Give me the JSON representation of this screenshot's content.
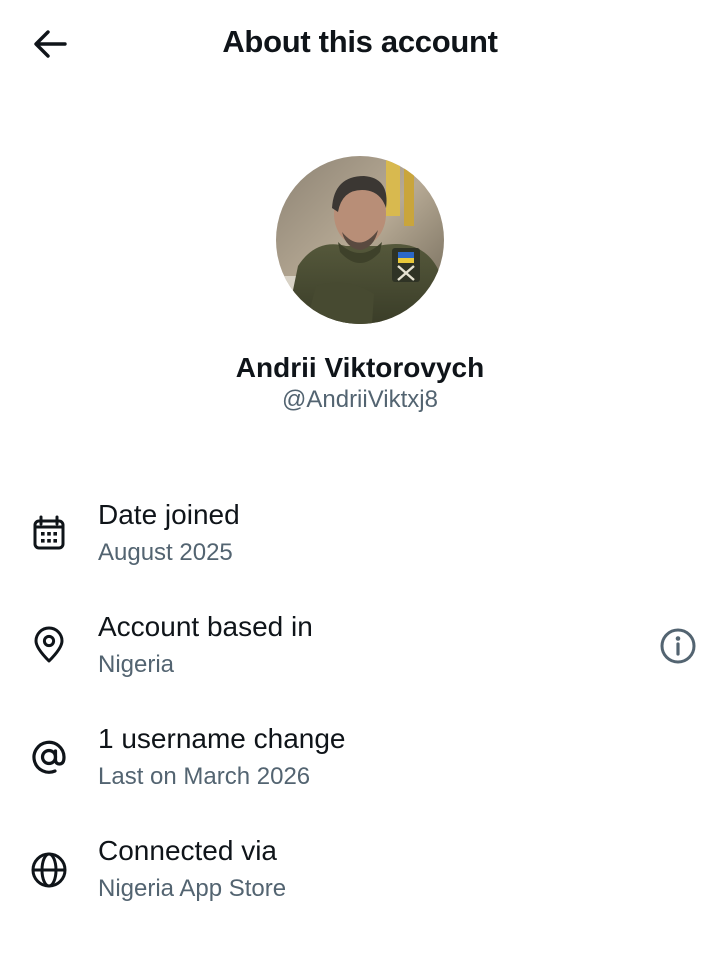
{
  "header": {
    "title": "About this account",
    "back_icon": "arrow-left-icon"
  },
  "profile": {
    "display_name": "Andrii Viktorovych",
    "handle": "@AndriiViktxj8",
    "avatar_icon": "profile-photo"
  },
  "details": [
    {
      "icon": "calendar-icon",
      "title": "Date joined",
      "value": "August 2025"
    },
    {
      "icon": "location-pin-icon",
      "title": "Account based in",
      "value": "Nigeria",
      "action_icon": "info-icon"
    },
    {
      "icon": "at-sign-icon",
      "title": "1 username change",
      "value": "Last on March 2026"
    },
    {
      "icon": "globe-icon",
      "title": "Connected via",
      "value": "Nigeria App Store"
    }
  ],
  "colors": {
    "text_primary": "#0f1419",
    "text_secondary": "#536471",
    "background": "#ffffff"
  }
}
